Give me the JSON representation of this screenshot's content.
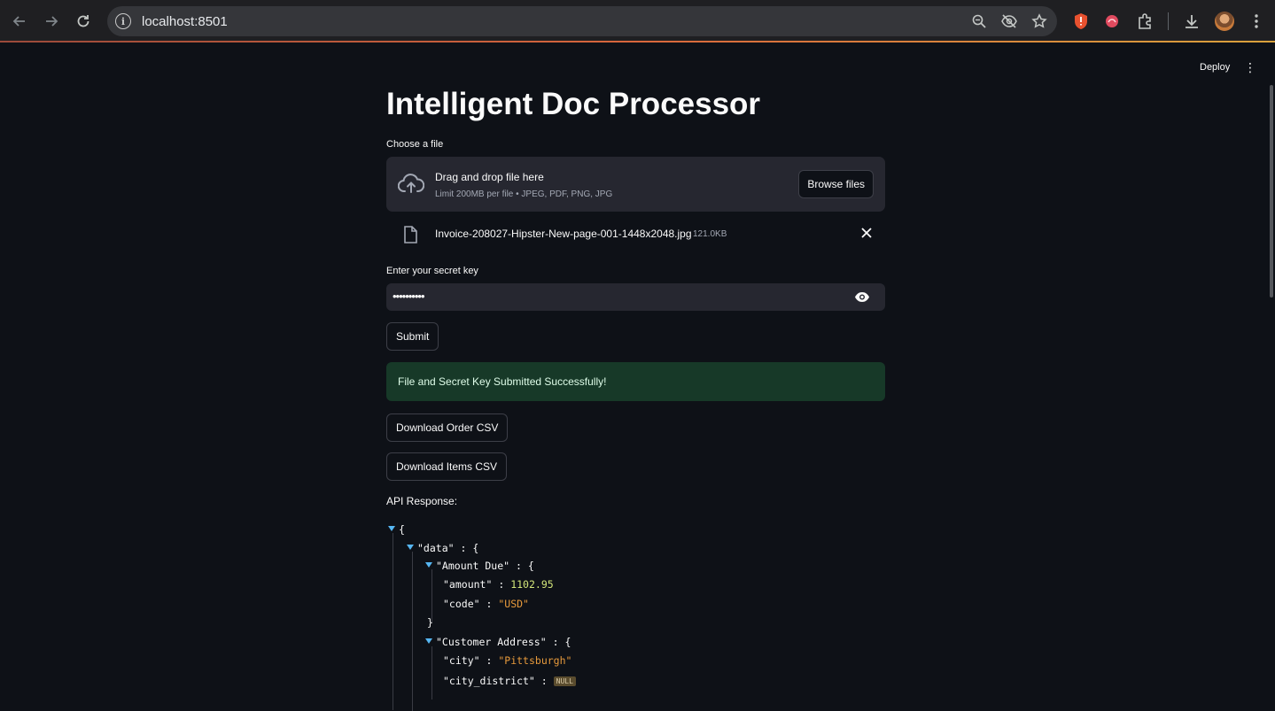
{
  "browser": {
    "url": "localhost:8501",
    "icons": [
      "back-icon",
      "forward-icon",
      "reload-icon",
      "site-info-icon",
      "zoom-icon",
      "tracking-hidden-icon",
      "bookmark-star-icon",
      "brave-shield-icon",
      "extension-icon",
      "puzzle-icon",
      "download-icon",
      "profile-avatar",
      "menu-icon"
    ]
  },
  "header": {
    "deploy_label": "Deploy",
    "menu_label": "⋮"
  },
  "app": {
    "title": "Intelligent Doc Processor",
    "uploader": {
      "label": "Choose a file",
      "drop_text": "Drag and drop file here",
      "limit_text": "Limit 200MB per file • JPEG, PDF, PNG, JPG",
      "browse_label": "Browse files"
    },
    "uploaded_file": {
      "name": "Invoice-208027-Hipster-New-page-001-1448x2048.jpg",
      "size": "121.0KB"
    },
    "secret": {
      "label": "Enter your secret key",
      "masked_value": "••••••••••"
    },
    "submit_label": "Submit",
    "success_message": "File and Secret Key Submitted Successfully!",
    "download_order_label": "Download Order CSV",
    "download_items_label": "Download Items CSV",
    "api_label": "API Response:"
  },
  "json_view": {
    "open_brace": "{",
    "data_key": "\"data\"",
    "colon": ":",
    "amount_due_key": "\"Amount Due\"",
    "amount_key": "\"amount\"",
    "amount_value": "1102.95",
    "code_key": "\"code\"",
    "code_value": "\"USD\"",
    "close_brace": "}",
    "customer_address_key": "\"Customer Address\"",
    "city_key": "\"city\"",
    "city_value": "\"Pittsburgh\"",
    "city_district_key": "\"city_district\"",
    "null_label": "NULL"
  },
  "colors": {
    "background": "#0e1117",
    "surface": "#262730",
    "success_bg": "#173928",
    "json_number": "#d3e67a",
    "json_string": "#e79a3c",
    "caret": "#56b6f2"
  }
}
